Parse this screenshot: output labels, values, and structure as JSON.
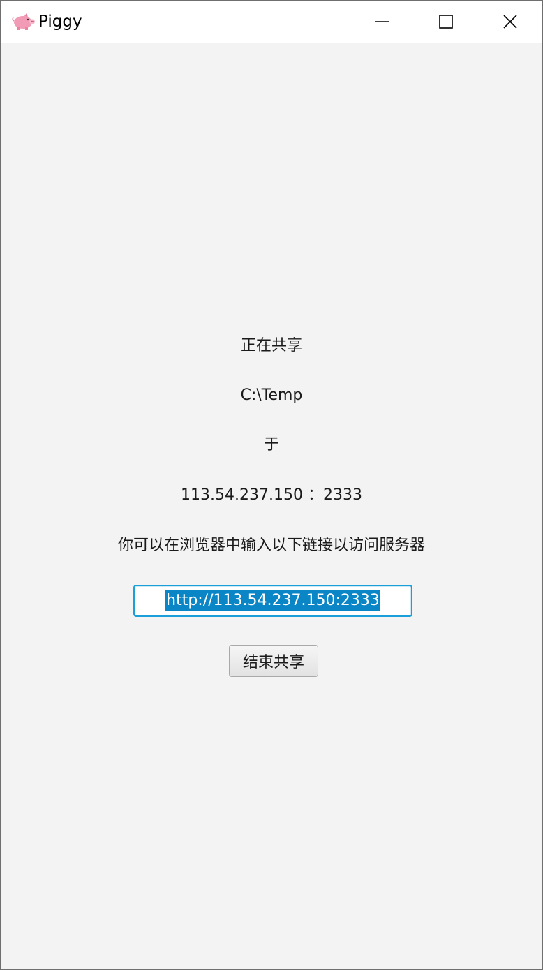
{
  "window": {
    "title": "Piggy",
    "icon": "pig-icon",
    "controls": {
      "minimize_icon": "minimize-icon",
      "maximize_icon": "maximize-icon",
      "close_icon": "close-icon"
    }
  },
  "main": {
    "sharing_label": "正在共享",
    "shared_path": "C:\\Temp",
    "at_label": "于",
    "address_ip": "113.54.237.150",
    "address_separator": "：",
    "address_port": "2333",
    "hint": "你可以在浏览器中输入以下链接以访问服务器",
    "url_value": "http://113.54.237.150:2333",
    "stop_button_label": "结束共享"
  },
  "colors": {
    "window_background": "#f3f3f3",
    "titlebar_background": "#ffffff",
    "selection_highlight": "#0a85c6",
    "focus_border": "#1a9fd9"
  }
}
